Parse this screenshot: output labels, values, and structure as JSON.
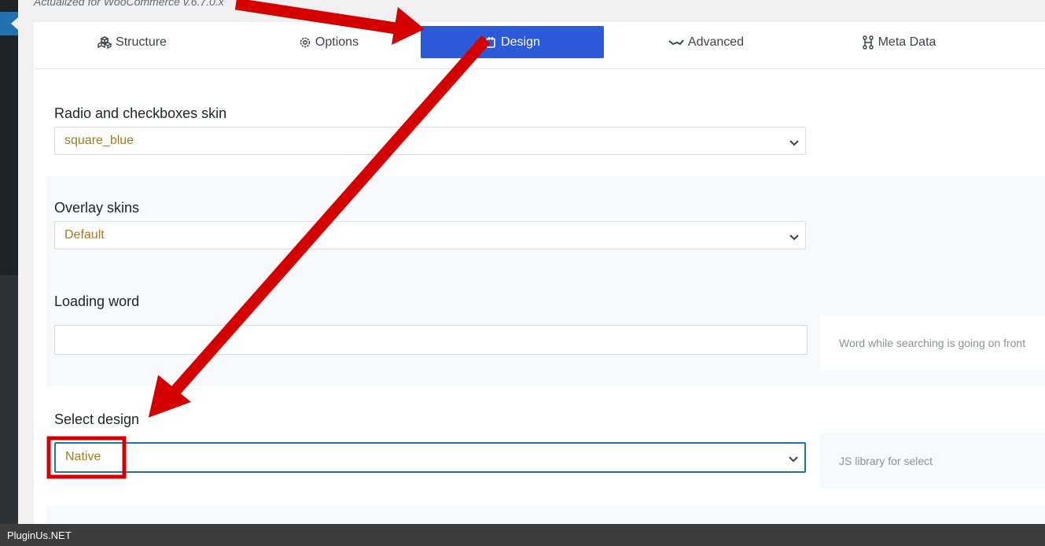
{
  "header": {
    "actualized_text": "Actualized for WooCommerce v.6.7.0.x"
  },
  "tabs": [
    {
      "label": "Structure",
      "icon": "cubes-icon",
      "active": false
    },
    {
      "label": "Options",
      "icon": "gear-icon",
      "active": false
    },
    {
      "label": "Design",
      "icon": "paint-icon",
      "active": true
    },
    {
      "label": "Advanced",
      "icon": "wave-icon",
      "active": false
    },
    {
      "label": "Meta Data",
      "icon": "network-icon",
      "active": false
    }
  ],
  "settings": {
    "radio_skin": {
      "label": "Radio and checkboxes skin",
      "value": "square_blue"
    },
    "overlay_skins": {
      "label": "Overlay skins",
      "value": "Default"
    },
    "loading_word": {
      "label": "Loading word",
      "value": "",
      "hint": "Word while searching is going on front"
    },
    "select_design": {
      "label": "Select design",
      "value": "Native",
      "hint": "JS library for select"
    }
  },
  "footer": {
    "watermark": "PluginUs.NET"
  },
  "colors": {
    "active_tab": "#2c5ad8",
    "value_text": "#a6791d",
    "annotation_red": "#d40000",
    "focus_border": "#2271b1"
  }
}
